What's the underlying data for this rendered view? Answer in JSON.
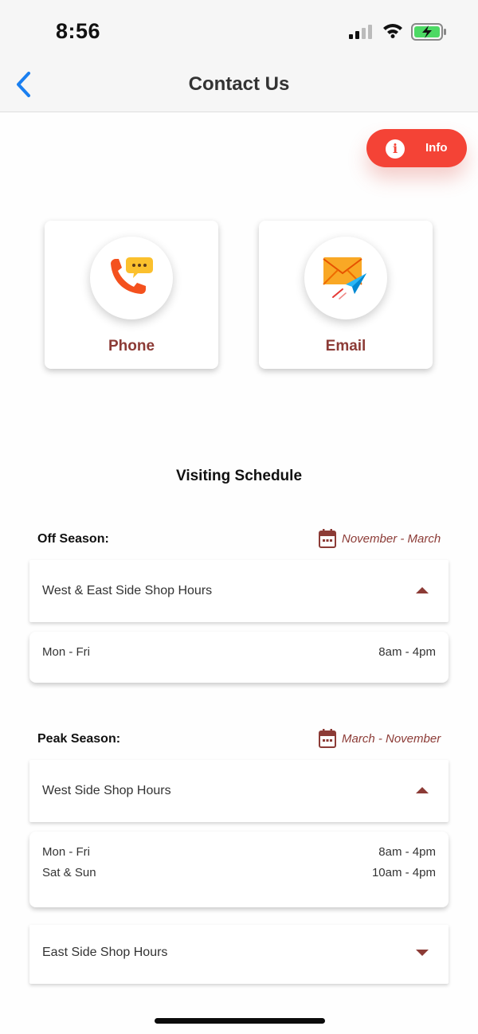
{
  "status_bar": {
    "time": "8:56",
    "icons": [
      "cellular-signal-icon",
      "wifi-icon",
      "battery-charging-icon"
    ]
  },
  "nav": {
    "back_icon": "chevron-left-icon",
    "title": "Contact Us"
  },
  "info_button": {
    "label": "Info",
    "icon": "info-icon",
    "icon_glyph": "i",
    "color": "#f44336"
  },
  "contact_options": [
    {
      "label": "Phone",
      "icon": "phone-chat-icon"
    },
    {
      "label": "Email",
      "icon": "email-paper-plane-icon"
    }
  ],
  "schedule": {
    "title": "Visiting Schedule",
    "off_season": {
      "label": "Off Season:",
      "range": "November - March",
      "accordions": [
        {
          "title": "West & East Side Shop Hours",
          "expanded": true,
          "rows": [
            {
              "days": "Mon - Fri",
              "hours": "8am - 4pm"
            }
          ]
        }
      ]
    },
    "peak_season": {
      "label": "Peak Season:",
      "range": "March - November",
      "accordions": [
        {
          "title": "West Side Shop Hours",
          "expanded": true,
          "rows": [
            {
              "days": "Mon - Fri",
              "hours": "8am - 4pm"
            },
            {
              "days": "Sat & Sun",
              "hours": "10am - 4pm"
            }
          ]
        },
        {
          "title": "East Side Shop Hours",
          "expanded": false,
          "rows": []
        }
      ]
    }
  },
  "colors": {
    "accent": "#8c3b36",
    "info_red": "#f44336",
    "ios_blue": "#1a7ff0"
  }
}
